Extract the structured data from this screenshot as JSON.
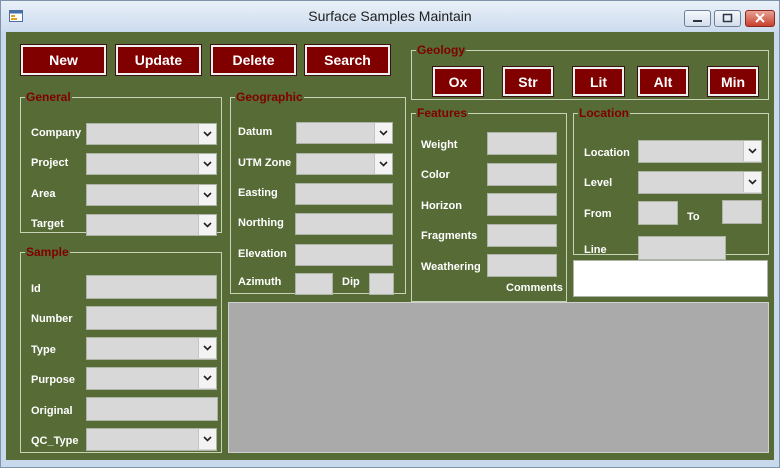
{
  "window": {
    "title": "Surface Samples Maintain",
    "controls": [
      "minimize-icon",
      "maximize-icon",
      "close-icon"
    ]
  },
  "toolbar": {
    "new_label": "New",
    "update_label": "Update",
    "delete_label": "Delete",
    "search_label": "Search"
  },
  "geology": {
    "title": "Geology",
    "buttons": [
      "Ox",
      "Str",
      "Lit",
      "Alt",
      "Min"
    ]
  },
  "general": {
    "title": "General",
    "company_label": "Company",
    "project_label": "Project",
    "area_label": "Area",
    "target_label": "Target"
  },
  "geographic": {
    "title": "Geographic",
    "datum_label": "Datum",
    "utm_zone_label": "UTM Zone",
    "easting_label": "Easting",
    "northing_label": "Northing",
    "elevation_label": "Elevation",
    "azimuth_label": "Azimuth",
    "dip_label": "Dip"
  },
  "features": {
    "title": "Features",
    "weight_label": "Weight",
    "color_label": "Color",
    "horizon_label": "Horizon",
    "fragments_label": "Fragments",
    "weathering_label": "Weathering"
  },
  "location": {
    "title": "Location",
    "location_label": "Location",
    "level_label": "Level",
    "from_label": "From",
    "to_label": "To",
    "line_label": "Line"
  },
  "sample": {
    "title": "Sample",
    "id_label": "Id",
    "number_label": "Number",
    "type_label": "Type",
    "purpose_label": "Purpose",
    "original_label": "Original",
    "qc_type_label": "QC_Type"
  },
  "comments": {
    "label": "Comments"
  },
  "colors": {
    "form_background": "#566b35",
    "button_fill": "#800000",
    "group_title": "#800000",
    "label_text": "#ffffff",
    "field_fill": "#d8d8d8",
    "grid_fill": "#aaaaaa"
  }
}
